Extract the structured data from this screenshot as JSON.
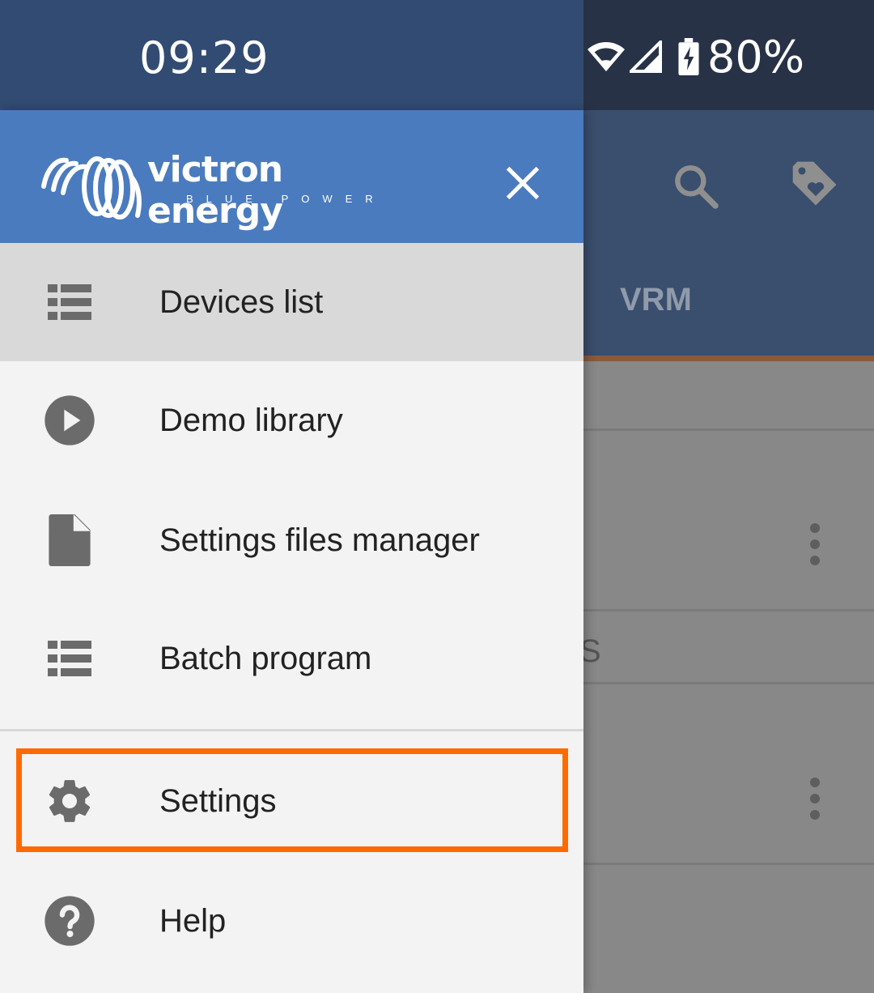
{
  "status_bar": {
    "time": "09:29",
    "battery_percent": "80%"
  },
  "drawer": {
    "logo": {
      "wordmark": "victron energy",
      "tagline": "BLUE POWER"
    },
    "items": [
      {
        "label": "Devices list",
        "icon": "list-icon",
        "selected": true
      },
      {
        "label": "Demo library",
        "icon": "play-circle-icon"
      },
      {
        "label": "Settings files manager",
        "icon": "file-icon"
      },
      {
        "label": "Batch program",
        "icon": "list-icon"
      },
      {
        "label": "Settings",
        "icon": "gear-icon",
        "highlighted": true
      },
      {
        "label": "Help",
        "icon": "help-circle-icon"
      }
    ]
  },
  "background": {
    "tab_label": "VRM",
    "partial_text": "S"
  },
  "colors": {
    "header_blue": "#4b7bbf",
    "status_bar": "#324b72",
    "highlight": "#ff6a00",
    "selected_row": "#d9d9d9"
  }
}
